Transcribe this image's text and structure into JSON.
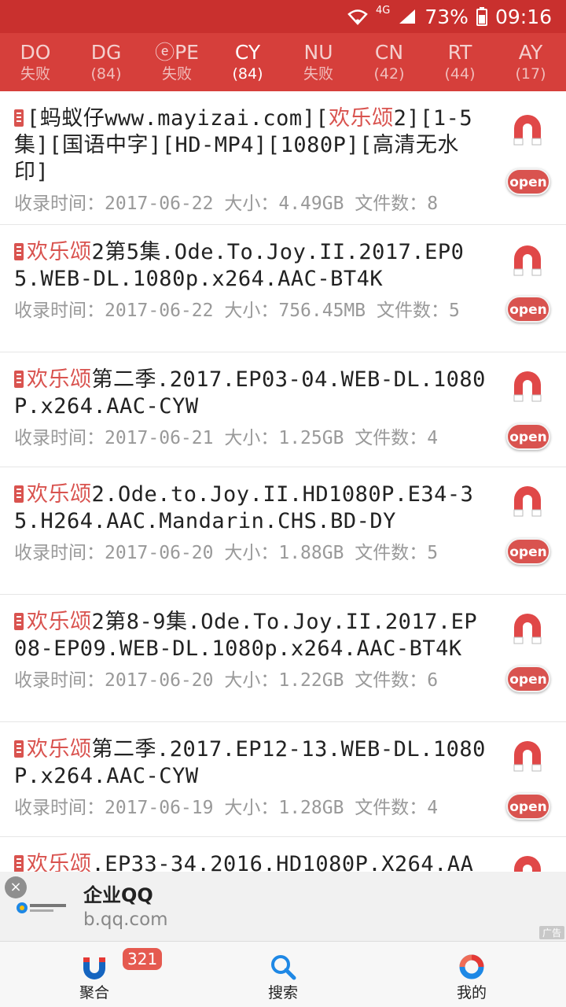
{
  "status_bar": {
    "network": "4G",
    "battery": "73%",
    "time": "09:16"
  },
  "tabs": [
    {
      "code": "DO",
      "sub": "失败"
    },
    {
      "code": "DG",
      "sub": "(84)"
    },
    {
      "code": "ⓔPE",
      "sub": "失败"
    },
    {
      "code": "CY",
      "sub": "(84)"
    },
    {
      "code": "NU",
      "sub": "失败"
    },
    {
      "code": "CN",
      "sub": "(42)"
    },
    {
      "code": "RT",
      "sub": "(44)"
    },
    {
      "code": "AY",
      "sub": "(17)"
    }
  ],
  "active_tab": "CY",
  "results": [
    {
      "pre": "[蚂蚁仔www.mayizai.com][",
      "hl": "欢乐颂",
      "post": "2][1-5集][国语中字][HD-MP4][1080P][高清无水印]",
      "date": "2017-06-22",
      "size": "4.49GB",
      "files": "8"
    },
    {
      "pre": "",
      "hl": "欢乐颂",
      "post": "2第5集.Ode.To.Joy.II.2017.EP05.WEB-DL.1080p.x264.AAC-BT4K",
      "date": "2017-06-22",
      "size": "756.45MB",
      "files": "5"
    },
    {
      "pre": "",
      "hl": "欢乐颂",
      "post": "第二季.2017.EP03-04.WEB-DL.1080P.x264.AAC-CYW",
      "date": "2017-06-21",
      "size": "1.25GB",
      "files": "4"
    },
    {
      "pre": "",
      "hl": "欢乐颂",
      "post": "2.Ode.to.Joy.II.HD1080P.E34-35.H264.AAC.Mandarin.CHS.BD-DY",
      "date": "2017-06-20",
      "size": "1.88GB",
      "files": "5"
    },
    {
      "pre": "",
      "hl": "欢乐颂",
      "post": "2第8-9集.Ode.To.Joy.II.2017.EP08-EP09.WEB-DL.1080p.x264.AAC-BT4K",
      "date": "2017-06-20",
      "size": "1.22GB",
      "files": "6"
    },
    {
      "pre": "",
      "hl": "欢乐颂",
      "post": "第二季.2017.EP12-13.WEB-DL.1080P.x264.AAC-CYW",
      "date": "2017-06-19",
      "size": "1.28GB",
      "files": "4"
    },
    {
      "pre": "",
      "hl": "欢乐颂",
      "post": ".EP33-34.2016.HD1080P.X264.AA",
      "date": "",
      "size": "",
      "files": ""
    }
  ],
  "labels": {
    "date_prefix": "收录时间：",
    "size_prefix": "大小：",
    "files_prefix": "文件数：",
    "open": "open"
  },
  "ad": {
    "close": "×",
    "title": "企业QQ",
    "url": "b.qq.com",
    "badge": "广告"
  },
  "bottom_nav": [
    {
      "label": "聚合",
      "badge": "321",
      "icon": "magnet-icon"
    },
    {
      "label": "搜索",
      "icon": "search-icon"
    },
    {
      "label": "我的",
      "icon": "profile-ring-icon"
    }
  ],
  "colors": {
    "accent": "#d63f3b",
    "highlight": "#d9534f"
  }
}
